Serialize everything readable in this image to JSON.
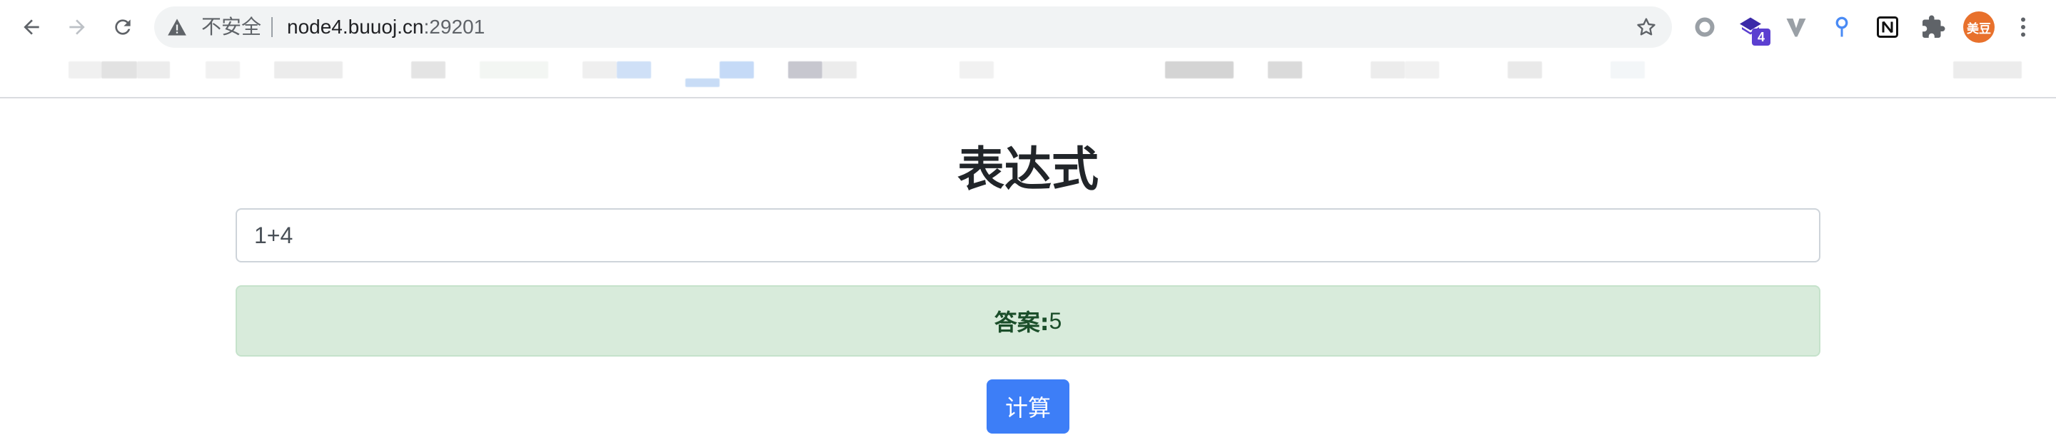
{
  "browser": {
    "security_label": "不安全",
    "url_host": "node4.buuoj.cn",
    "url_port": ":29201",
    "extensions": [
      "record-icon",
      "stack-icon",
      "vimium-icon",
      "pin-icon",
      "notion-icon",
      "puzzle-icon"
    ],
    "stack_badge": "4",
    "avatar_text": "美豆"
  },
  "page": {
    "title": "表达式",
    "expression_value": "1+4",
    "answer_label": "答案:",
    "answer_value": "5",
    "calculate_button": "计算"
  },
  "colors": {
    "accent": "#3d7ef7",
    "success_bg": "#d8ebdb",
    "success_text": "#1b4e2a"
  }
}
